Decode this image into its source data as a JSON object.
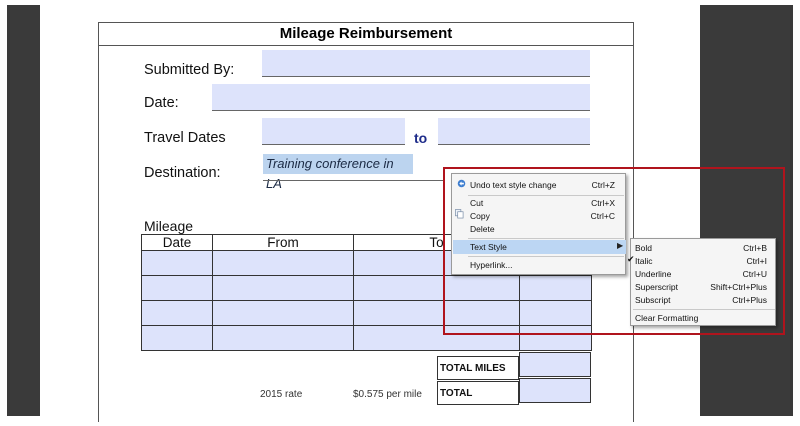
{
  "form": {
    "title": "Mileage Reimbursement",
    "submitted_by_label": "Submitted By:",
    "date_label": "Date:",
    "travel_dates_label": "Travel Dates",
    "to_label": "to",
    "destination_label": "Destination:",
    "destination_value": "Training conference in LA",
    "mileage_label": "Mileage",
    "columns": [
      "Date",
      "From",
      "To"
    ],
    "rate_label": "2015 rate",
    "rate_value": "$0.575 per mile",
    "total_miles_label": "TOTAL MILES",
    "total_label": "TOTAL"
  },
  "context_menu": {
    "undo": {
      "label": "Undo text style change",
      "shortcut": "Ctrl+Z"
    },
    "cut": {
      "label": "Cut",
      "shortcut": "Ctrl+X"
    },
    "copy": {
      "label": "Copy",
      "shortcut": "Ctrl+C"
    },
    "delete": {
      "label": "Delete"
    },
    "text_style": {
      "label": "Text Style"
    },
    "hyperlink": {
      "label": "Hyperlink..."
    }
  },
  "submenu": {
    "bold": {
      "label": "Bold",
      "shortcut": "Ctrl+B"
    },
    "italic": {
      "label": "Italic",
      "shortcut": "Ctrl+I",
      "checked": true
    },
    "underline": {
      "label": "Underline",
      "shortcut": "Ctrl+U"
    },
    "superscript": {
      "label": "Superscript",
      "shortcut": "Shift+Ctrl+Plus"
    },
    "subscript": {
      "label": "Subscript",
      "shortcut": "Ctrl+Plus"
    },
    "clear_formatting": {
      "label": "Clear Formatting"
    }
  },
  "colors": {
    "field_fill": "#dde3fb",
    "selection_fill": "#bcd4ef",
    "highlight": "#bcd6f3",
    "annotation_border": "#b0141d"
  }
}
